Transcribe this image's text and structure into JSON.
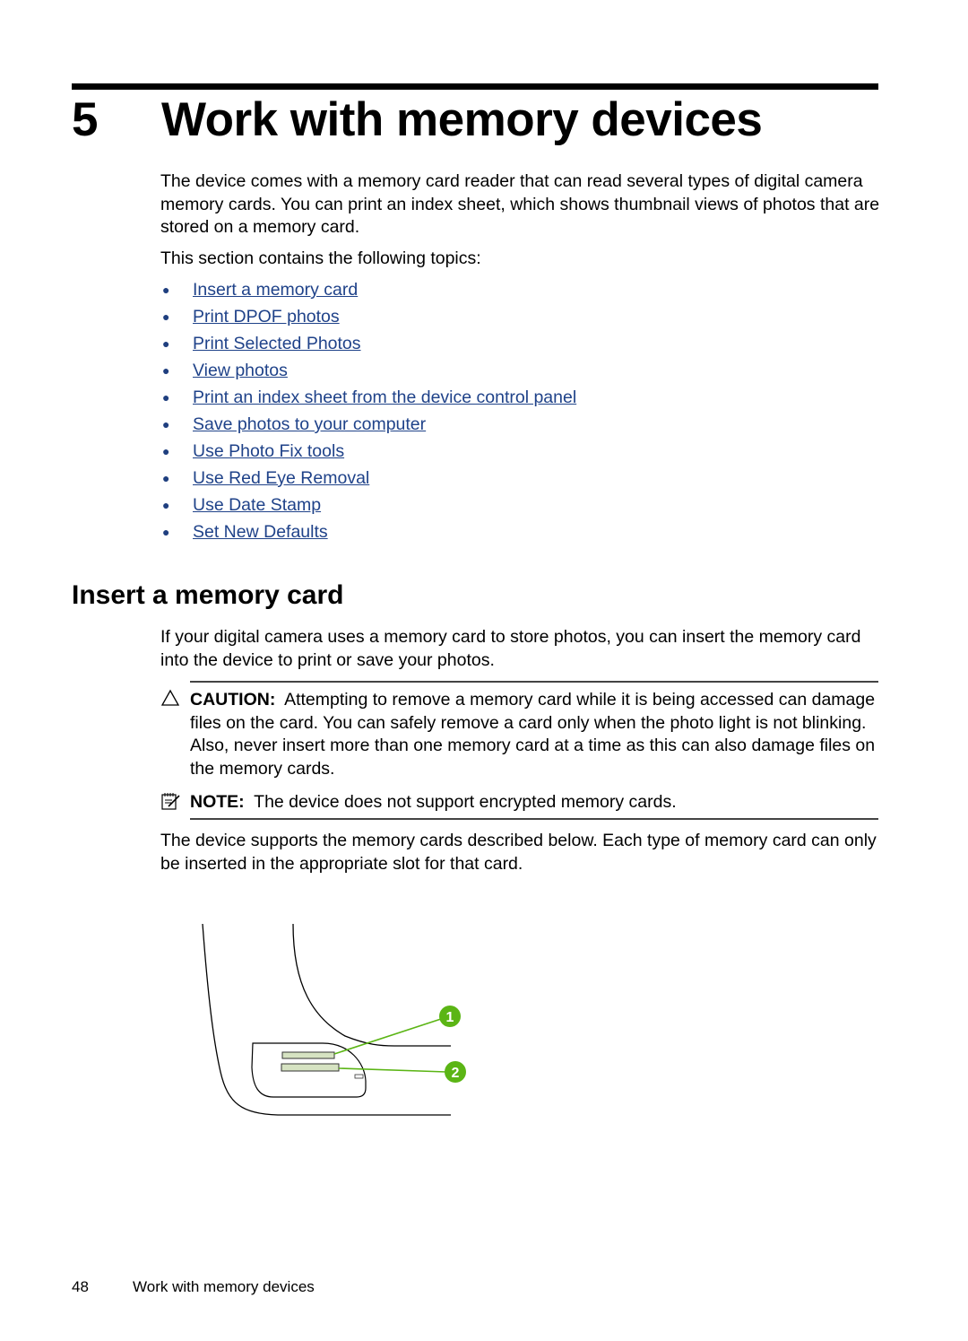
{
  "chapter": {
    "number": "5",
    "title": "Work with memory devices"
  },
  "intro": "The device comes with a memory card reader that can read several types of digital camera memory cards. You can print an index sheet, which shows thumbnail views of photos that are stored on a memory card.",
  "topics_intro": "This section contains the following topics:",
  "topics": [
    "Insert a memory card",
    "Print DPOF photos",
    "Print Selected Photos",
    "View photos",
    "Print an index sheet from the device control panel",
    "Save photos to your computer",
    "Use Photo Fix tools",
    "Use Red Eye Removal",
    "Use Date Stamp",
    "Set New Defaults"
  ],
  "section": {
    "title": "Insert a memory card",
    "body": "If your digital camera uses a memory card to store photos, you can insert the memory card into the device to print or save your photos.",
    "caution": {
      "label": "CAUTION:",
      "text": "Attempting to remove a memory card while it is being accessed can damage files on the card. You can safely remove a card only when the photo light is not blinking. Also, never insert more than one memory card at a time as this can also damage files on the memory cards."
    },
    "note": {
      "label": "NOTE:",
      "text": "The device does not support encrypted memory cards."
    },
    "body2": "The device supports the memory cards described below. Each type of memory card can only be inserted in the appropriate slot for that card.",
    "figure": {
      "callouts": [
        "1",
        "2"
      ],
      "callout_color": "#5bb515"
    }
  },
  "footer": {
    "page": "48",
    "title": "Work with memory devices"
  },
  "colors": {
    "link": "#1f4289",
    "callout": "#5bb515"
  }
}
